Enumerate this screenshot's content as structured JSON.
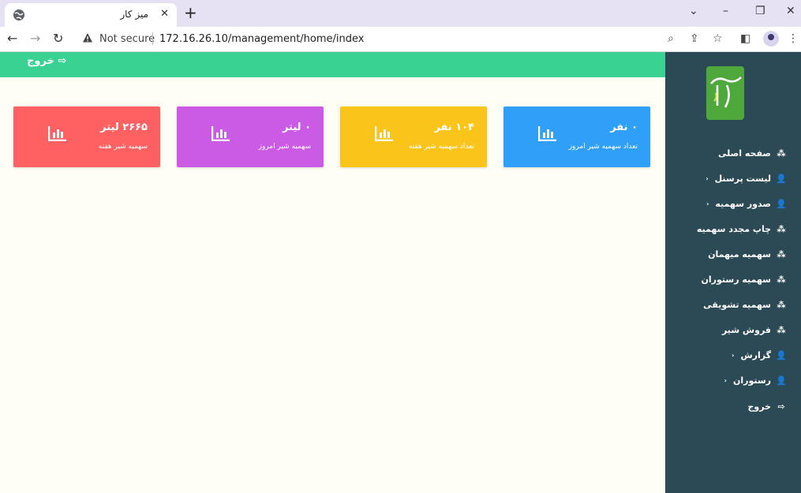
{
  "browser": {
    "tab_title": "میز کار",
    "url": "172.16.26.10/management/home/index",
    "security_label": "Not secure"
  },
  "page": {
    "top_logout": "خروج",
    "cards": [
      {
        "value": "۰ نفر",
        "label": "تعداد سهمیه شیر امروز",
        "color": "#2f9ff7"
      },
      {
        "value": "۱۰۴ نفر",
        "label": "تعداد سهمیه شیر هفته",
        "color": "#fbc41b"
      },
      {
        "value": "۰ لیتر",
        "label": "سهمیه شیر امروز",
        "color": "#cb5be4"
      },
      {
        "value": "۲۶۶۵ لیتر",
        "label": "سهمیه شیر هفته",
        "color": "#ff6162"
      }
    ]
  },
  "sidebar": {
    "items": [
      {
        "label": "صفحه اصلی",
        "icon": "cubes-icon"
      },
      {
        "label": "لیست پرسنل",
        "icon": "user-icon",
        "chevron": true
      },
      {
        "label": "صدور سهمیه",
        "icon": "user-icon",
        "chevron": true
      },
      {
        "label": "چاپ مجدد سهمیه",
        "icon": "cubes-icon"
      },
      {
        "label": "سهمیه میهمان",
        "icon": "cubes-icon"
      },
      {
        "label": "سهمیه رستوران",
        "icon": "cubes-icon"
      },
      {
        "label": "سهمیه تشویقی",
        "icon": "cubes-icon"
      },
      {
        "label": "فروش شیر",
        "icon": "cubes-icon"
      },
      {
        "label": "گزارش",
        "icon": "user-icon",
        "chevron": true
      },
      {
        "label": "رستوران",
        "icon": "user-icon",
        "chevron": true
      },
      {
        "label": "خروج",
        "icon": "sign-out-icon"
      }
    ]
  },
  "colors": {
    "topbar": "#39d293",
    "sidebar": "#2c4a55",
    "page_bg": "#fffef4"
  }
}
